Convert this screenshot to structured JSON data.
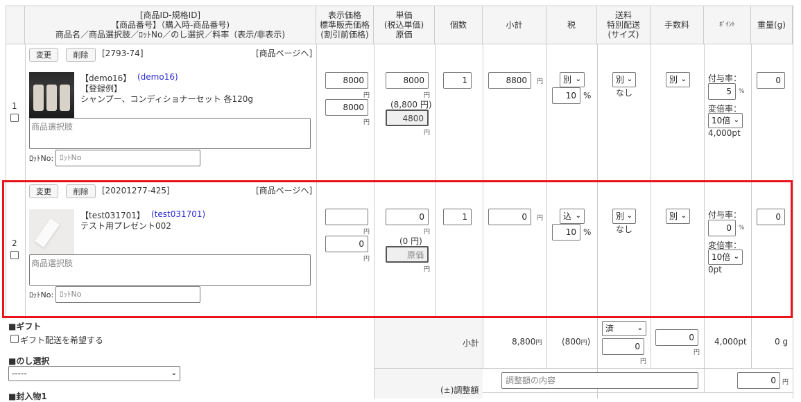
{
  "header": {
    "col_product": [
      "[商品ID-規格ID]",
      "【商品番号】（購入時-商品番号)",
      "商品名／商品選択肢／ﾛｯﾄNo／のし選択／料率（表示/非表示)"
    ],
    "col_price": [
      "表示価格",
      "標準販売価格",
      "(割引前価格)"
    ],
    "col_unit": [
      "単価",
      "(税込単価)",
      "原価"
    ],
    "col_qty": "個数",
    "col_subtotal": "小計",
    "col_tax": "税",
    "col_shipping": [
      "送料",
      "特別配送",
      "(サイズ)"
    ],
    "col_fee": "手数料",
    "col_point": "ﾎﾟｲﾝﾄ",
    "col_weight": "重量(g)"
  },
  "rows": [
    {
      "index": "1",
      "change_label": "変更",
      "delete_label": "削除",
      "id": "[2793-74]",
      "page_link": "[商品ページへ]",
      "code": "【demo16】",
      "purchase_code": "(demo16)",
      "note": "【登録例】",
      "name": "シャンプー、コンディショナーセット 各120g",
      "option_placeholder": "商品選択肢",
      "lot_label": "ﾛｯﾄNo:",
      "lot_placeholder": "ﾛｯﾄNo",
      "display_price": "8000",
      "standard_price": "8000",
      "yen": "円",
      "unit_price": "8000",
      "tax_incl": "(8,800 円)",
      "cost": "4800",
      "qty": "1",
      "subtotal": "8800",
      "tax_mode": "別",
      "tax_rate": "10",
      "percent": "%",
      "shipping_mode": "別",
      "shipping_size": "なし",
      "fee_mode": "別",
      "grant_label": "付与率：",
      "grant_rate": "5",
      "multiplier_label": "変倍率：",
      "multiplier": "10倍",
      "points": "4,000pt",
      "weight": "0"
    },
    {
      "index": "2",
      "change_label": "変更",
      "delete_label": "削除",
      "id": "[20201277-425]",
      "page_link": "[商品ページへ]",
      "code": "【test031701】",
      "purchase_code": "(test031701)",
      "note": "",
      "name": "テスト用プレゼント002",
      "option_placeholder": "商品選択肢",
      "lot_label": "ﾛｯﾄNo:",
      "lot_placeholder": "ﾛｯﾄNo",
      "display_price": "",
      "standard_price": "0",
      "yen": "円",
      "unit_price": "0",
      "tax_incl": "(0 円)",
      "cost": "原価",
      "qty": "1",
      "subtotal": "0",
      "tax_mode": "込",
      "tax_rate": "10",
      "percent": "%",
      "shipping_mode": "別",
      "shipping_size": "なし",
      "fee_mode": "別",
      "grant_label": "付与率：",
      "grant_rate": "0",
      "multiplier_label": "変倍率：",
      "multiplier": "10倍",
      "points": "0pt",
      "weight": "0"
    }
  ],
  "bottom": {
    "gift_heading": "■ギフト",
    "gift_checkbox_label": "ギフト配送を希望する",
    "noshi_heading": "■のし選択",
    "noshi_value": "-----",
    "enclosure_heading": "■封入物1",
    "subtotal_label": "小計",
    "subtotal_value": "8,800",
    "yen": "円",
    "tax_value": "(800",
    "tax_close": ")",
    "shipping_status": "済",
    "shipping_value": "0",
    "fee_value": "0",
    "points_total": "4,000pt",
    "weight_total": "0 g",
    "adjust_label": "(±)調整額",
    "adjust_placeholder": "調整額の内容",
    "adjust_value": "0"
  }
}
